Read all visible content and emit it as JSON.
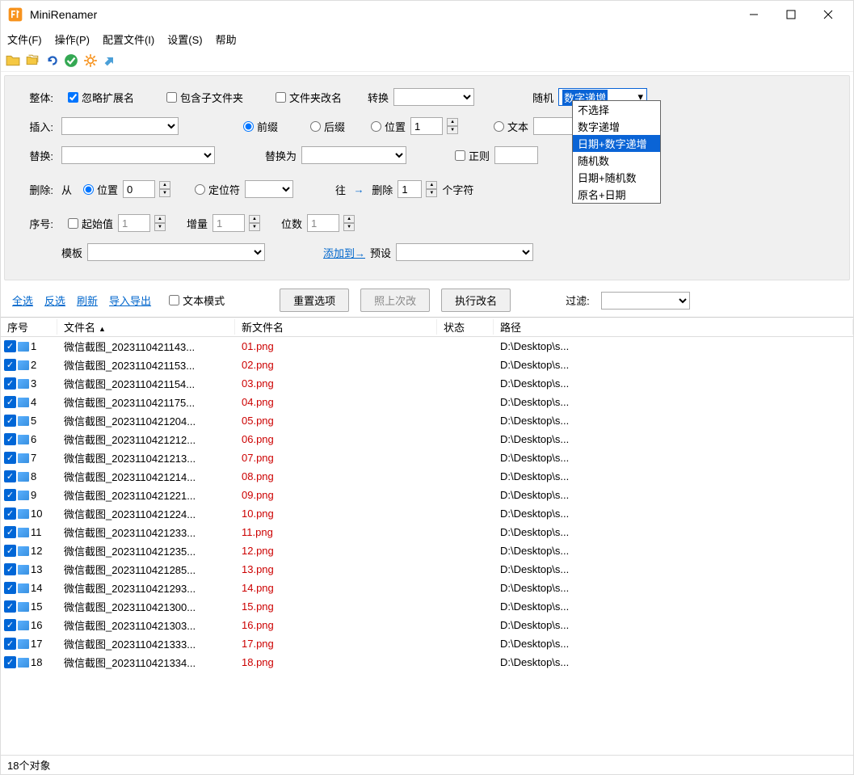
{
  "window": {
    "title": "MiniRenamer"
  },
  "menu": {
    "file": "文件(F)",
    "op": "操作(P)",
    "config": "配置文件(I)",
    "settings": "设置(S)",
    "help": "帮助"
  },
  "panel": {
    "total": "整体:",
    "ignoreExt": "忽略扩展名",
    "incSub": "包含子文件夹",
    "folderRename": "文件夹改名",
    "transform": "转换",
    "random": "随机",
    "randomSel": "数字递增",
    "randomOpts": [
      "不选择",
      "数字递增",
      "日期+数字递增",
      "随机数",
      "日期+随机数",
      "原名+日期"
    ],
    "randomHighlight": 2,
    "insert": "插入:",
    "prefix": "前缀",
    "suffix": "后缀",
    "position": "位置",
    "posVal": "1",
    "text": "文本",
    "replace": "替换:",
    "replaceWith": "替换为",
    "regex": "正则",
    "delete": "删除:",
    "from": "从",
    "pos2": "位置",
    "posVal2": "0",
    "locator": "定位符",
    "to": "往",
    "delLbl": "删除",
    "delVal": "1",
    "chars": "个字符",
    "seq": "序号:",
    "start": "起始值",
    "startVal": "1",
    "inc": "增量",
    "incVal": "1",
    "digits": "位数",
    "digitsVal": "1",
    "template": "模板",
    "addTo": "添加到→",
    "preset": "预设"
  },
  "links": {
    "selAll": "全选",
    "inv": "反选",
    "refresh": "刷新",
    "impExp": "导入导出",
    "textMode": "文本模式",
    "reset": "重置选项",
    "lastChange": "照上次改",
    "execute": "执行改名",
    "filter": "过滤:"
  },
  "cols": {
    "seq": "序号",
    "name": "文件名",
    "newName": "新文件名",
    "status": "状态",
    "path": "路径"
  },
  "rows": [
    {
      "n": "1",
      "f": "微信截图_2023110421143...",
      "nn": "01.png",
      "p": "D:\\Desktop\\s..."
    },
    {
      "n": "2",
      "f": "微信截图_2023110421153...",
      "nn": "02.png",
      "p": "D:\\Desktop\\s..."
    },
    {
      "n": "3",
      "f": "微信截图_2023110421154...",
      "nn": "03.png",
      "p": "D:\\Desktop\\s..."
    },
    {
      "n": "4",
      "f": "微信截图_2023110421175...",
      "nn": "04.png",
      "p": "D:\\Desktop\\s..."
    },
    {
      "n": "5",
      "f": "微信截图_2023110421204...",
      "nn": "05.png",
      "p": "D:\\Desktop\\s..."
    },
    {
      "n": "6",
      "f": "微信截图_2023110421212...",
      "nn": "06.png",
      "p": "D:\\Desktop\\s..."
    },
    {
      "n": "7",
      "f": "微信截图_2023110421213...",
      "nn": "07.png",
      "p": "D:\\Desktop\\s..."
    },
    {
      "n": "8",
      "f": "微信截图_2023110421214...",
      "nn": "08.png",
      "p": "D:\\Desktop\\s..."
    },
    {
      "n": "9",
      "f": "微信截图_2023110421221...",
      "nn": "09.png",
      "p": "D:\\Desktop\\s..."
    },
    {
      "n": "10",
      "f": "微信截图_2023110421224...",
      "nn": "10.png",
      "p": "D:\\Desktop\\s..."
    },
    {
      "n": "11",
      "f": "微信截图_2023110421233...",
      "nn": "11.png",
      "p": "D:\\Desktop\\s..."
    },
    {
      "n": "12",
      "f": "微信截图_2023110421235...",
      "nn": "12.png",
      "p": "D:\\Desktop\\s..."
    },
    {
      "n": "13",
      "f": "微信截图_2023110421285...",
      "nn": "13.png",
      "p": "D:\\Desktop\\s..."
    },
    {
      "n": "14",
      "f": "微信截图_2023110421293...",
      "nn": "14.png",
      "p": "D:\\Desktop\\s..."
    },
    {
      "n": "15",
      "f": "微信截图_2023110421300...",
      "nn": "15.png",
      "p": "D:\\Desktop\\s..."
    },
    {
      "n": "16",
      "f": "微信截图_2023110421303...",
      "nn": "16.png",
      "p": "D:\\Desktop\\s..."
    },
    {
      "n": "17",
      "f": "微信截图_2023110421333...",
      "nn": "17.png",
      "p": "D:\\Desktop\\s..."
    },
    {
      "n": "18",
      "f": "微信截图_2023110421334...",
      "nn": "18.png",
      "p": "D:\\Desktop\\s..."
    }
  ],
  "status": "18个对象"
}
